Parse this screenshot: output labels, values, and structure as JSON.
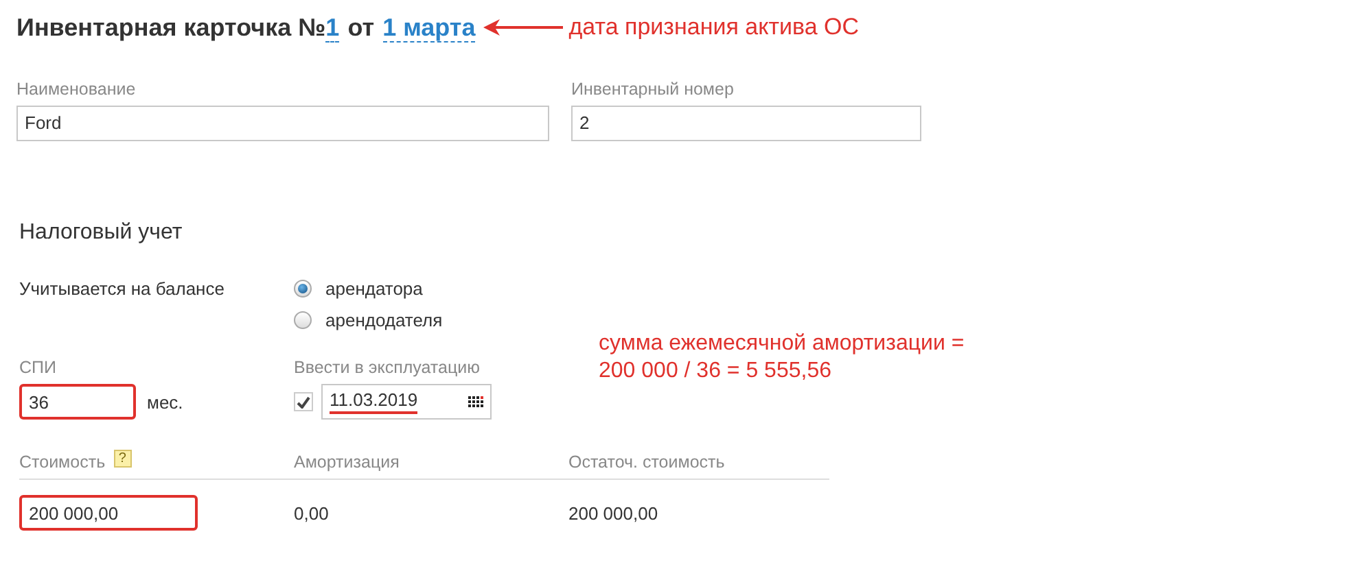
{
  "header": {
    "title": "Инвентарная карточка №",
    "number": "1",
    "from": "от",
    "date": "1 марта",
    "annotation": "дата признания актива ОС"
  },
  "fields": [
    {
      "label": "Наименование",
      "value": "Ford"
    },
    {
      "label": "Инвентарный номер",
      "value": "2"
    }
  ],
  "tax": {
    "title": "Налоговый учет",
    "balance_label": "Учитывается на балансе",
    "options": [
      {
        "label": "арендатора",
        "selected": true
      },
      {
        "label": "арендодателя",
        "selected": false
      }
    ],
    "spi": {
      "label": "СПИ",
      "value": "36",
      "unit": "мес.",
      "highlighted": true
    },
    "commissioning": {
      "label": "Ввести в эксплуатацию",
      "checked": true,
      "value": "11.03.2019",
      "highlighted": true
    },
    "note": [
      "сумма ежемесячной амортизации =",
      "200 000 / 36 = 5 555,56"
    ]
  },
  "table": {
    "columns": [
      {
        "label": "Стоимость",
        "help": "?"
      },
      {
        "label": "Амортизация"
      },
      {
        "label": "Остаточ. стоимость"
      }
    ],
    "values": [
      {
        "kind": "field",
        "value": "200 000,00",
        "highlighted": true
      },
      {
        "kind": "text",
        "value": "0,00"
      },
      {
        "kind": "text",
        "value": "200 000,00"
      }
    ]
  }
}
